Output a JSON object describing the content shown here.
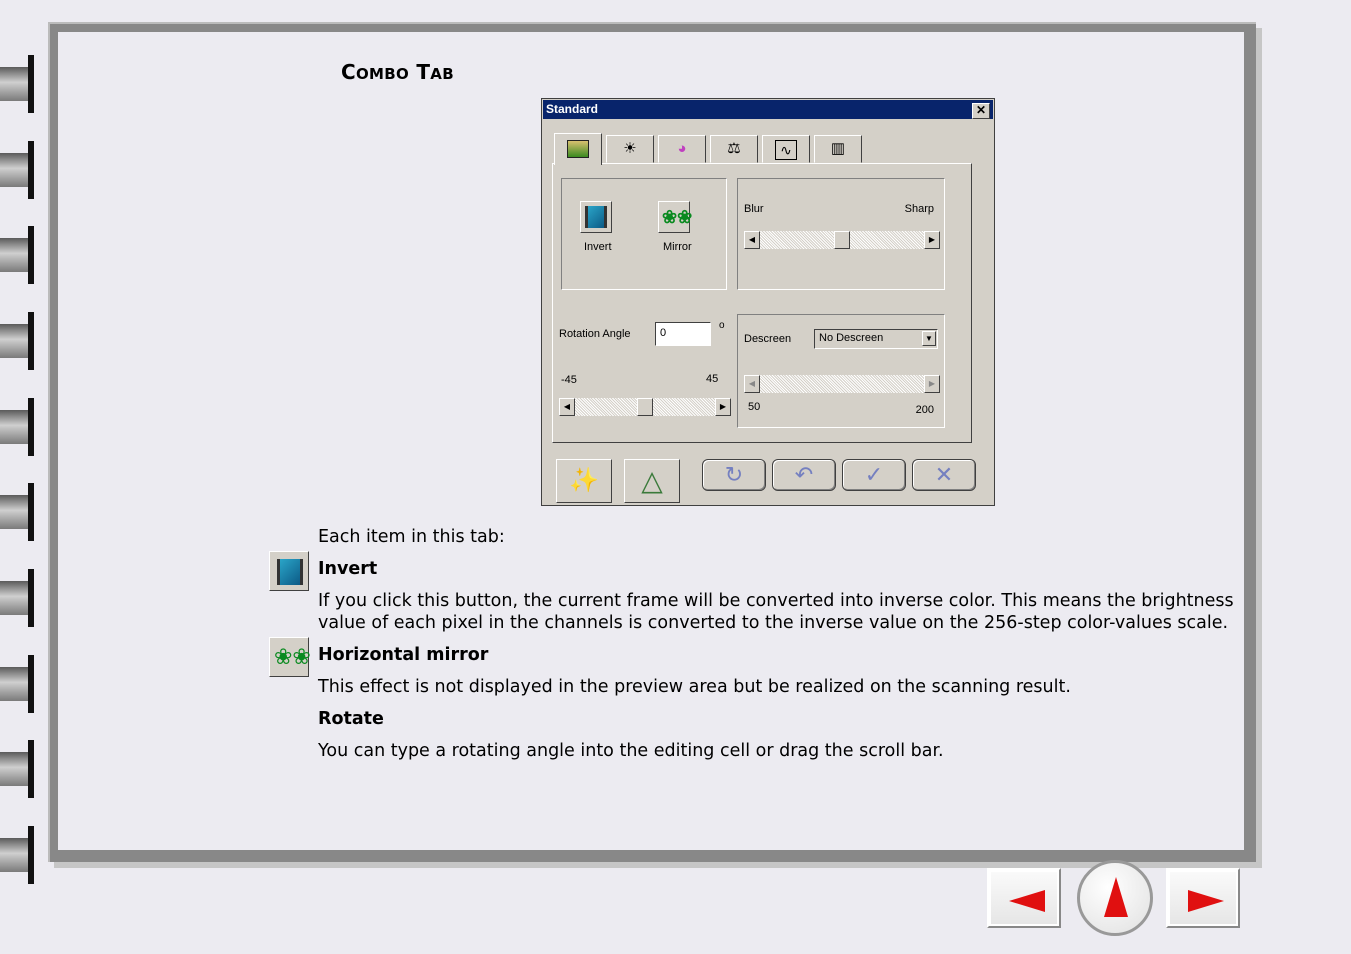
{
  "heading": {
    "first_cap": "C",
    "first_rest": "OMBO",
    "second_cap": "T",
    "second_rest": "AB"
  },
  "dialog": {
    "title": "Standard",
    "close_glyph": "✕",
    "tabs": [
      {
        "icon": "image-icon",
        "glyph": "▇"
      },
      {
        "icon": "brightness-icon",
        "glyph": "☀"
      },
      {
        "icon": "color-wheel-icon",
        "glyph": "◕"
      },
      {
        "icon": "balance-icon",
        "glyph": "⚖"
      },
      {
        "icon": "curve-icon",
        "glyph": "∿"
      },
      {
        "icon": "histogram-icon",
        "glyph": "▥"
      }
    ],
    "invert_label": "Invert",
    "mirror_label": "Mirror",
    "blur_label": "Blur",
    "sharp_label": "Sharp",
    "rotation_label": "Rotation Angle",
    "rotation_value": "0",
    "degree_symbol": "o",
    "rot_min": "-45",
    "rot_max": "45",
    "descreen_label": "Descreen",
    "descreen_value": "No Descreen",
    "descreen_min": "50",
    "descreen_max": "200",
    "bottom_buttons": [
      {
        "icon": "magic-wand-icon",
        "glyph": "✨"
      },
      {
        "icon": "triangle-icon",
        "glyph": "△"
      }
    ],
    "round_buttons": [
      {
        "icon": "refresh-icon",
        "glyph": "↻"
      },
      {
        "icon": "undo-icon",
        "glyph": "↶"
      },
      {
        "icon": "check-icon",
        "glyph": "✓"
      },
      {
        "icon": "cancel-icon",
        "glyph": "✕"
      }
    ],
    "sliders": {
      "sharpness_position": 0.5,
      "rotation_position": 0.5,
      "descreen_position": 0.0
    }
  },
  "body": {
    "intro": "Each item in this tab:",
    "invert_title": "Invert",
    "invert_desc_1": "If you click this button, the current frame will be converted into inverse color. This means the brightness",
    "invert_desc_2": "value of each pixel in the channels is converted to the inverse value on the 256-step color-values scale.",
    "mirror_title": "Horizontal mirror",
    "mirror_desc": "This effect is not displayed in the preview area but be realized on the scanning result.",
    "rotate_title": "Rotate",
    "rotate_desc": "You can type a rotating angle into the editing cell or drag the scroll bar."
  },
  "nav": {
    "prev": "previous-page",
    "up": "up",
    "next": "next-page"
  },
  "colors": {
    "accent": "#e01010",
    "title_bar": "#08246b",
    "page_bg": "#ecebf1"
  }
}
